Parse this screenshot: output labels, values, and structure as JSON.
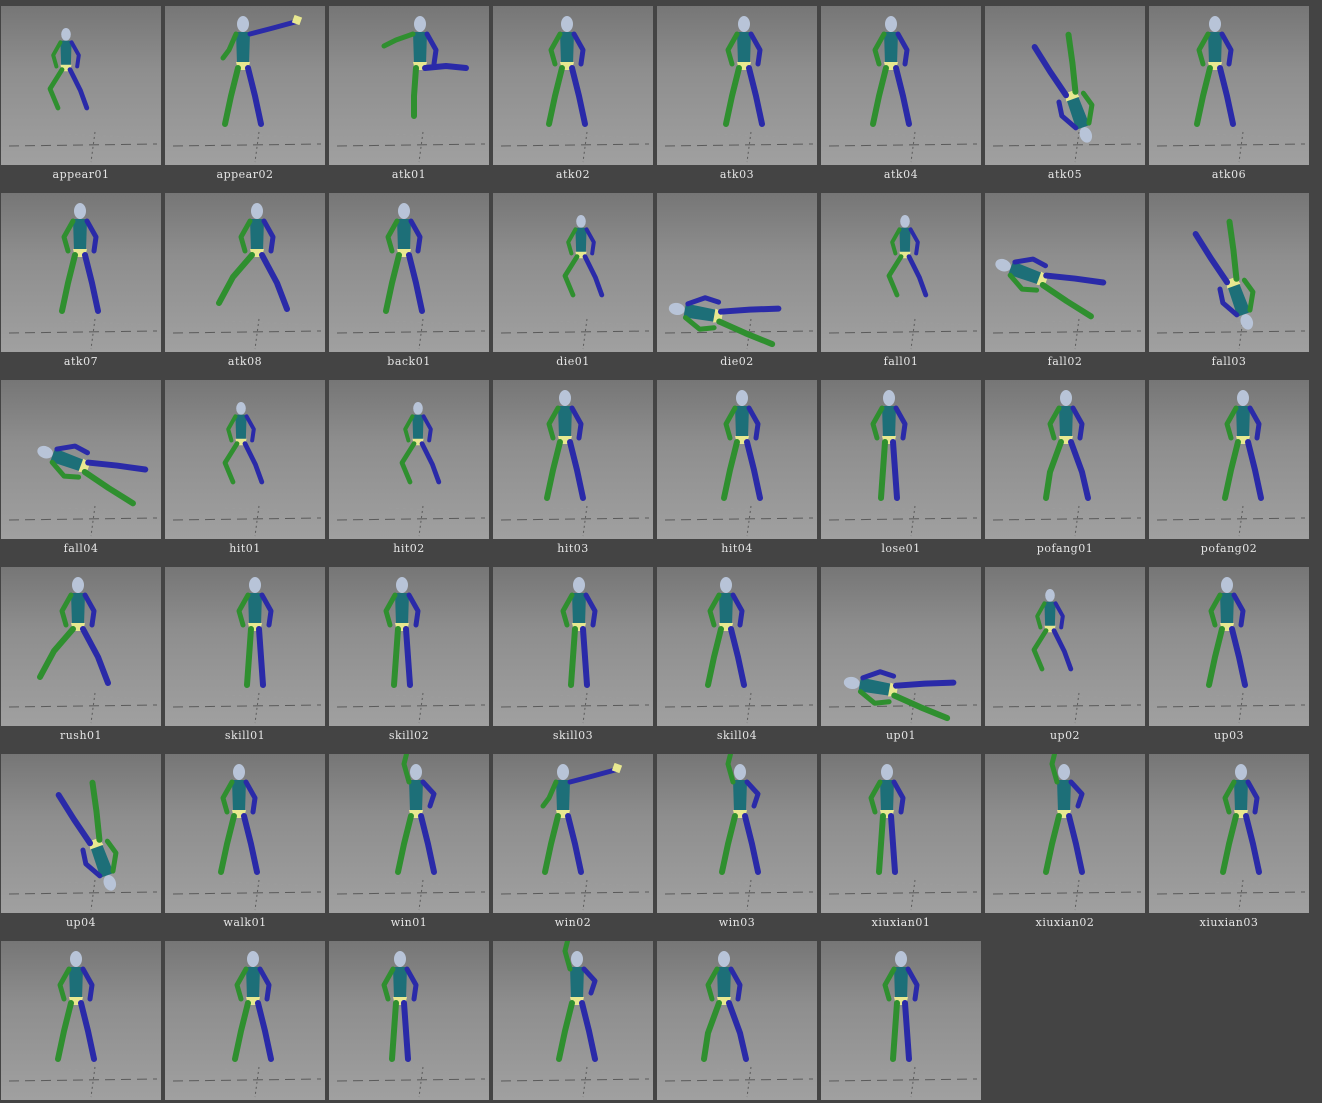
{
  "animations": [
    {
      "name": "appear01",
      "pose": "crouch"
    },
    {
      "name": "appear02",
      "pose": "point"
    },
    {
      "name": "atk01",
      "pose": "kick"
    },
    {
      "name": "atk02",
      "pose": "stance"
    },
    {
      "name": "atk03",
      "pose": "stance"
    },
    {
      "name": "atk04",
      "pose": "stance"
    },
    {
      "name": "atk05",
      "pose": "flip"
    },
    {
      "name": "atk06",
      "pose": "stance"
    },
    {
      "name": "atk07",
      "pose": "stance"
    },
    {
      "name": "atk08",
      "pose": "lunge"
    },
    {
      "name": "back01",
      "pose": "stance"
    },
    {
      "name": "die01",
      "pose": "kneel"
    },
    {
      "name": "die02",
      "pose": "lying"
    },
    {
      "name": "fall01",
      "pose": "kneel"
    },
    {
      "name": "fall02",
      "pose": "airborne"
    },
    {
      "name": "fall03",
      "pose": "flip"
    },
    {
      "name": "fall04",
      "pose": "airborne"
    },
    {
      "name": "hit01",
      "pose": "crouch"
    },
    {
      "name": "hit02",
      "pose": "crouch"
    },
    {
      "name": "hit03",
      "pose": "stance"
    },
    {
      "name": "hit04",
      "pose": "stance"
    },
    {
      "name": "lose01",
      "pose": "stand"
    },
    {
      "name": "pofang01",
      "pose": "bend"
    },
    {
      "name": "pofang02",
      "pose": "stance"
    },
    {
      "name": "rush01",
      "pose": "lunge"
    },
    {
      "name": "skill01",
      "pose": "stand"
    },
    {
      "name": "skill02",
      "pose": "stand"
    },
    {
      "name": "skill03",
      "pose": "stand"
    },
    {
      "name": "skill04",
      "pose": "stance"
    },
    {
      "name": "up01",
      "pose": "lying"
    },
    {
      "name": "up02",
      "pose": "kneel"
    },
    {
      "name": "up03",
      "pose": "stance"
    },
    {
      "name": "up04",
      "pose": "flip"
    },
    {
      "name": "walk01",
      "pose": "stance"
    },
    {
      "name": "win01",
      "pose": "cheer"
    },
    {
      "name": "win02",
      "pose": "point"
    },
    {
      "name": "win03",
      "pose": "cheer"
    },
    {
      "name": "xiuxian01",
      "pose": "stand"
    },
    {
      "name": "xiuxian02",
      "pose": "cheer"
    },
    {
      "name": "xiuxian03",
      "pose": "stance"
    },
    {
      "name": "",
      "pose": "stance"
    },
    {
      "name": "",
      "pose": "stance"
    },
    {
      "name": "",
      "pose": "stand"
    },
    {
      "name": "",
      "pose": "cheer"
    },
    {
      "name": "",
      "pose": "bend"
    },
    {
      "name": "",
      "pose": "stand"
    }
  ],
  "colors": {
    "background": "#444444",
    "limb_left": "#2f8f2f",
    "limb_right": "#2a2aa8",
    "torso": "#1d6f78",
    "head": "#b8c4d8",
    "accent": "#e8e890"
  }
}
